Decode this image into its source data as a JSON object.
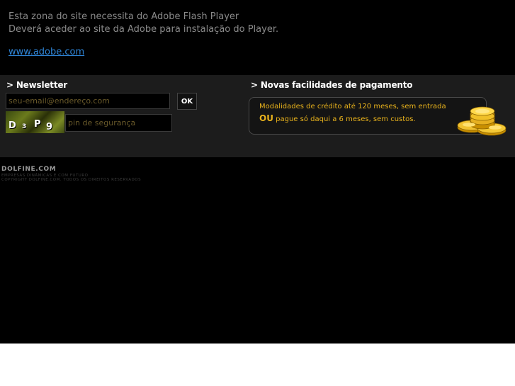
{
  "flash_notice": {
    "line1": "Esta zona do site necessita do Adobe Flash Player",
    "line2": "Deverá aceder ao site da Adobe para instalação do Player.",
    "link_text": "www.adobe.com"
  },
  "newsletter": {
    "title": "> Newsletter",
    "email_placeholder": "seu-email@endereço.com",
    "ok_label": "OK",
    "captcha_chars": [
      "D",
      "3",
      "P",
      "9"
    ],
    "pin_placeholder": "pin de segurança"
  },
  "payment": {
    "title": "> Novas facilidades de pagamento",
    "line1": "Modalidades de crédito até 120 meses, sem entrada",
    "line2_bold": "OU",
    "line2_rest": " pague só daqui a 6 meses, sem custos."
  },
  "footer": {
    "logo": "DOLFINE.COM",
    "tagline": "EMPRESAS DINÂMICAS E COM FUTURO",
    "copyright": "COPYRIGHT DOLFINE.COM. TODOS OS DIREITOS RESERVADOS"
  },
  "colors": {
    "background": "#000000",
    "band": "#1c1c1c",
    "link": "#2f86d9",
    "accent": "#e8b21c"
  }
}
